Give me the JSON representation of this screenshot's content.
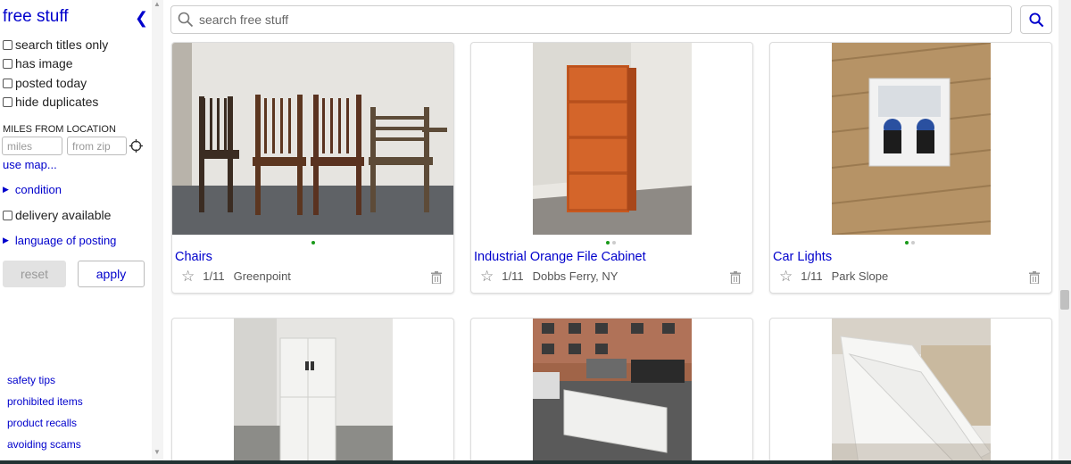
{
  "sidebar": {
    "title": "free stuff",
    "collapse_icon": "chevron-left-icon",
    "filters": {
      "search_titles_only": "search titles only",
      "has_image": "has image",
      "posted_today": "posted today",
      "hide_duplicates": "hide duplicates"
    },
    "miles_label": "MILES FROM LOCATION",
    "miles_placeholder": "miles",
    "zip_placeholder": "from zip",
    "use_map": "use map...",
    "condition": "condition",
    "delivery_available": "delivery available",
    "language_of_posting": "language of posting",
    "reset_label": "reset",
    "apply_label": "apply",
    "footer_links": [
      "safety tips",
      "prohibited items",
      "product recalls",
      "avoiding scams"
    ]
  },
  "search": {
    "placeholder": "search free stuff",
    "icon": "search-icon"
  },
  "colors": {
    "link": "#0000cc",
    "dot_active": "#1a9a1a"
  },
  "listings": [
    {
      "title": "Chairs",
      "date": "1/11",
      "location": "Greenpoint",
      "image_count": 1
    },
    {
      "title": "Industrial Orange File Cabinet",
      "date": "1/11",
      "location": "Dobbs Ferry, NY",
      "image_count": 2
    },
    {
      "title": "Car Lights",
      "date": "1/11",
      "location": "Park Slope",
      "image_count": 2
    },
    {
      "title": "",
      "date": "",
      "location": ""
    },
    {
      "title": "",
      "date": "",
      "location": ""
    },
    {
      "title": "",
      "date": "",
      "location": ""
    }
  ]
}
